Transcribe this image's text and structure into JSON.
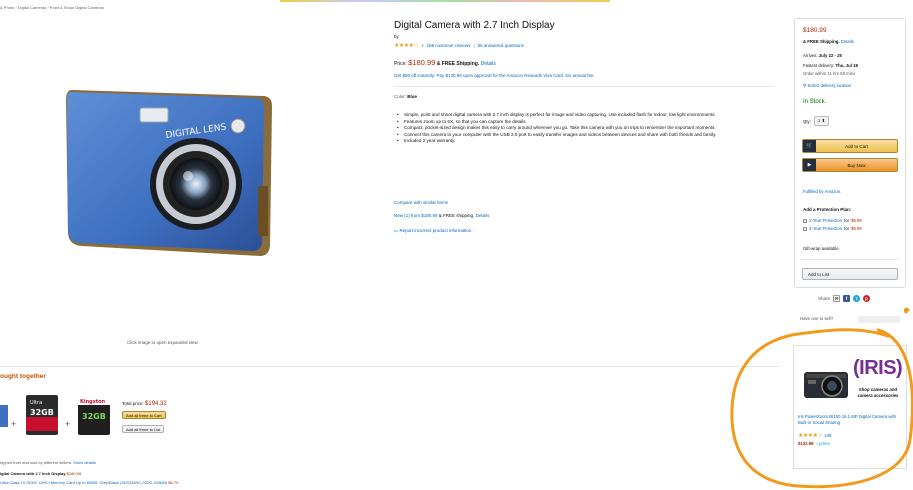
{
  "breadcrumb": "& Photo › Digital Cameras › Point & Shoot Digital Cameras",
  "image_caption": "Click image to open expanded view",
  "product": {
    "title": "Digital Camera with 2.7 Inch Display",
    "by": "by",
    "stars": "★★★★☆",
    "rating_chevron": "▾",
    "reviews": "188 customer reviews",
    "separator": "|",
    "answered": "56 answered questions",
    "price_label": "Price:",
    "price": "$180.99",
    "shipping_bold": "& FREE Shipping.",
    "details_link": "Details",
    "offer": "Get $50 off instantly: Pay $130.99 upon approval for the Amazon Rewards Visa Card. No annual fee.",
    "color_label": "Color:",
    "color_value": "Blue",
    "bullets": [
      "Simple, point and shoot digital camera with 2.7 inch display is perfect for image and video capturing. Use included flash for indoor, low light environments.",
      "Features zoom up to 6X, so that you can capture the details.",
      "Compact, pocket-sized design makes this easy to carry around wherever you go. Take this camera with you on trips to remember the important moments.",
      "Connect this camera to your computer with the USB 2.0 port to easily transfer images and videos between devices and share with both friends and family.",
      "Included 2 year warranty."
    ],
    "compare": "Compare with similar items",
    "new_link": "New (1) from $180.99",
    "new_shipping": "& FREE shipping.",
    "new_details": "Details",
    "report": "Report incorrect product information."
  },
  "buybox": {
    "price": "$180.99",
    "shipping": "& FREE Shipping.",
    "details": "Details",
    "arrives_label": "Arrives:",
    "arrives": "July 22 - 25",
    "fastest_label": "Fastest delivery:",
    "fastest": "Thu, Jul 18",
    "order_within": "Order within 11 hrs 59 mins",
    "pin_icon": "⚲",
    "deliver": "Select delivery location",
    "stock": "In Stock.",
    "qty_label": "Qty:",
    "qty": "1",
    "qty_chevron": "⬍",
    "cart_icon": "🛒",
    "add_to_cart": "Add to Cart",
    "buy_icon": "▶",
    "buy_now": "Buy Now",
    "fulfilled": "Fulfilled by Amazon.",
    "protection_title": "Add a Protection Plan:",
    "protection": [
      {
        "label": "2-Year Protection",
        "for_text": "for",
        "price": "$5.99"
      },
      {
        "label": "3-Year Protection",
        "for_text": "for",
        "price": "$5.99"
      }
    ],
    "gift": "Gift-wrap available.",
    "add_to_list": "Add to List",
    "share": "Share",
    "share_icons": {
      "email": "✉",
      "facebook": "f",
      "twitter": "t",
      "pinterest": "p"
    },
    "sell": "Have one to sell?"
  },
  "ad": {
    "logo": "(IRIS)",
    "tagline": "Shop cameras and camera accessories",
    "product": "Iris PowerZoom BI100 16.1 MP Digital Camera with Built-in Social Sharing",
    "stars": "★★★★☆",
    "reviews": "248",
    "price": "$132.98",
    "prime": "✓prime"
  },
  "fbt": {
    "title": "ought together",
    "total_label": "Total price:",
    "total": "$194.32",
    "add_all_cart": "Add all three to Cart",
    "add_all_list": "Add all three to List",
    "plus_sign": "+",
    "note": "hipped from and sold by different sellers.",
    "note_link": "Show details",
    "lines": [
      {
        "text": "igital Camera with 2.7 Inch Display",
        "price": "$180.99"
      },
      {
        "text": "Ultra Class 10 SDHC UHS-I Memory Card Up to 80MB, Grey/Black (SDSDUNC-032G-GN6IN)",
        "price": "$6.79"
      }
    ],
    "cards": [
      {
        "brand": "Ultra",
        "size": "32GB"
      },
      {
        "brand": "Kingston",
        "size": "32GB"
      }
    ]
  },
  "colors": {
    "link": "#0066c0",
    "price": "#b12704",
    "stock": "#007600",
    "fbt_title": "#c45500",
    "annotation": "#f39a1c",
    "star": "#e59d22"
  }
}
